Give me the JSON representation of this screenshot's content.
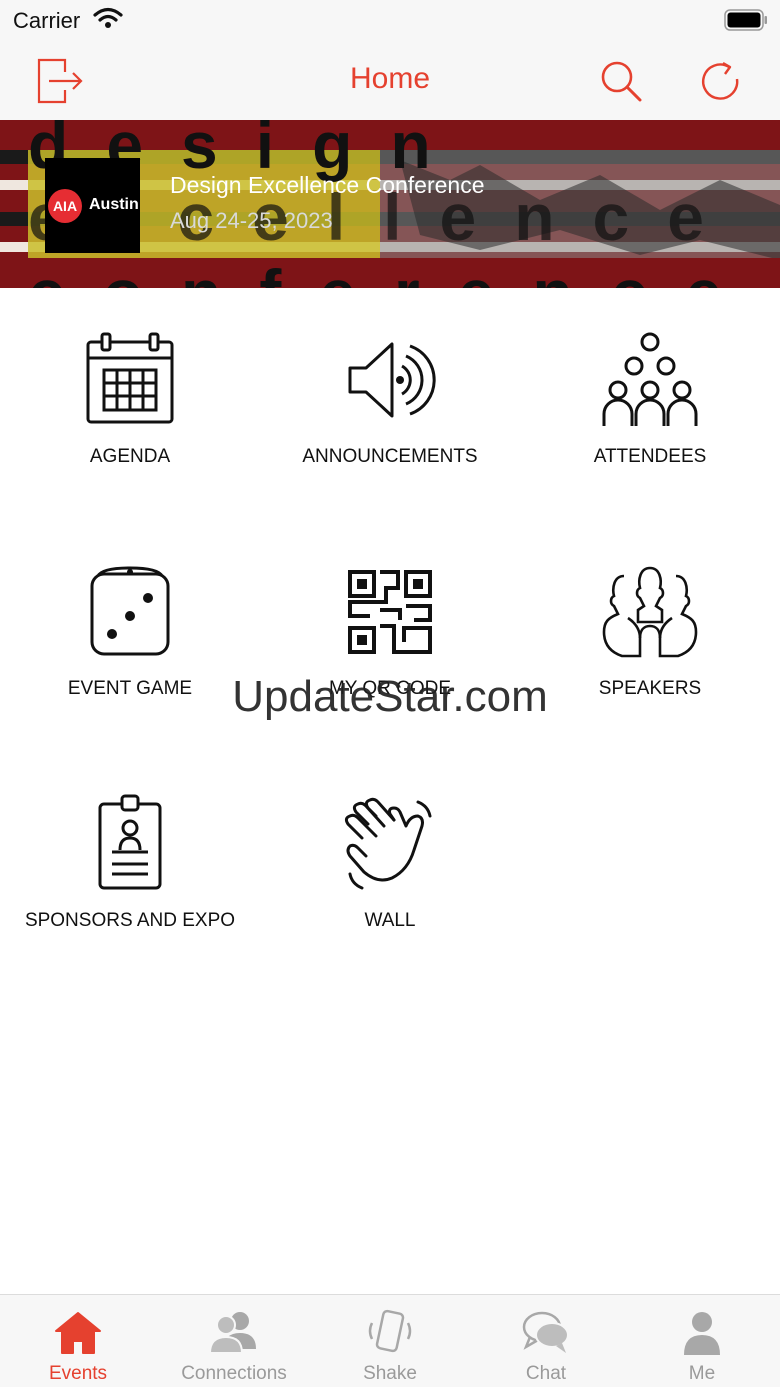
{
  "status_bar": {
    "carrier": "Carrier"
  },
  "nav": {
    "title": "Home"
  },
  "banner": {
    "bg_text_1": "design",
    "bg_text_2": "excellence",
    "bg_text_3": "conference",
    "logo_aia": "AIA",
    "logo_city": "Austin",
    "title": "Design Excellence Conference",
    "date": "Aug 24-25, 2023"
  },
  "grid": {
    "agenda": "AGENDA",
    "announcements": "ANNOUNCEMENTS",
    "attendees": "ATTENDEES",
    "event_game": "EVENT GAME",
    "my_qr_code": "MY QR CODE",
    "speakers": "SPEAKERS",
    "sponsors": "SPONSORS AND EXPO",
    "wall": "WALL"
  },
  "watermark": "UpdateStar.com",
  "tabs": {
    "events": "Events",
    "connections": "Connections",
    "shake": "Shake",
    "chat": "Chat",
    "me": "Me"
  },
  "colors": {
    "accent": "#e5412f",
    "banner": "#7e1417",
    "inactive": "#9a9a9a"
  }
}
